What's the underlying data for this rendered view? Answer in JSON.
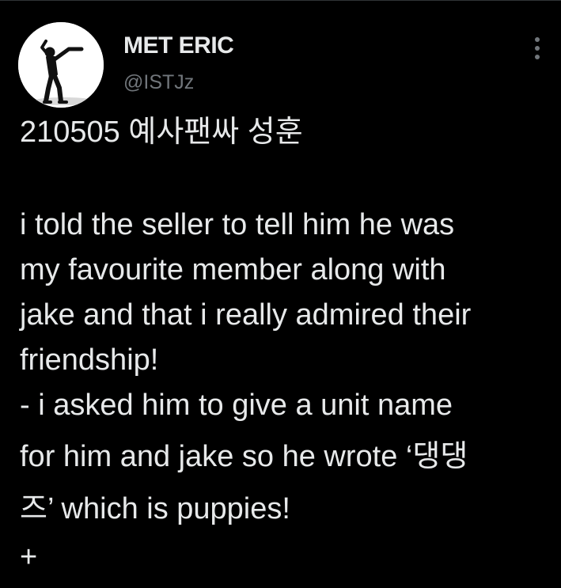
{
  "tweet": {
    "display_name": "MET ERIC",
    "handle": "@ISTJz",
    "more_icon": "more-vertical-icon",
    "lines": [
      "210505 예사팬싸 성훈",
      "i told the seller to tell him he was",
      "my favourite member along with",
      "jake and that i really admired their",
      "friendship!",
      "- i asked him to give a unit name",
      "for him and jake so he wrote ‘댕댕",
      "즈’ which is puppies!",
      "+"
    ]
  },
  "colors": {
    "background": "#000000",
    "primary_text": "#e7e9ea",
    "secondary_text": "#71767b"
  }
}
